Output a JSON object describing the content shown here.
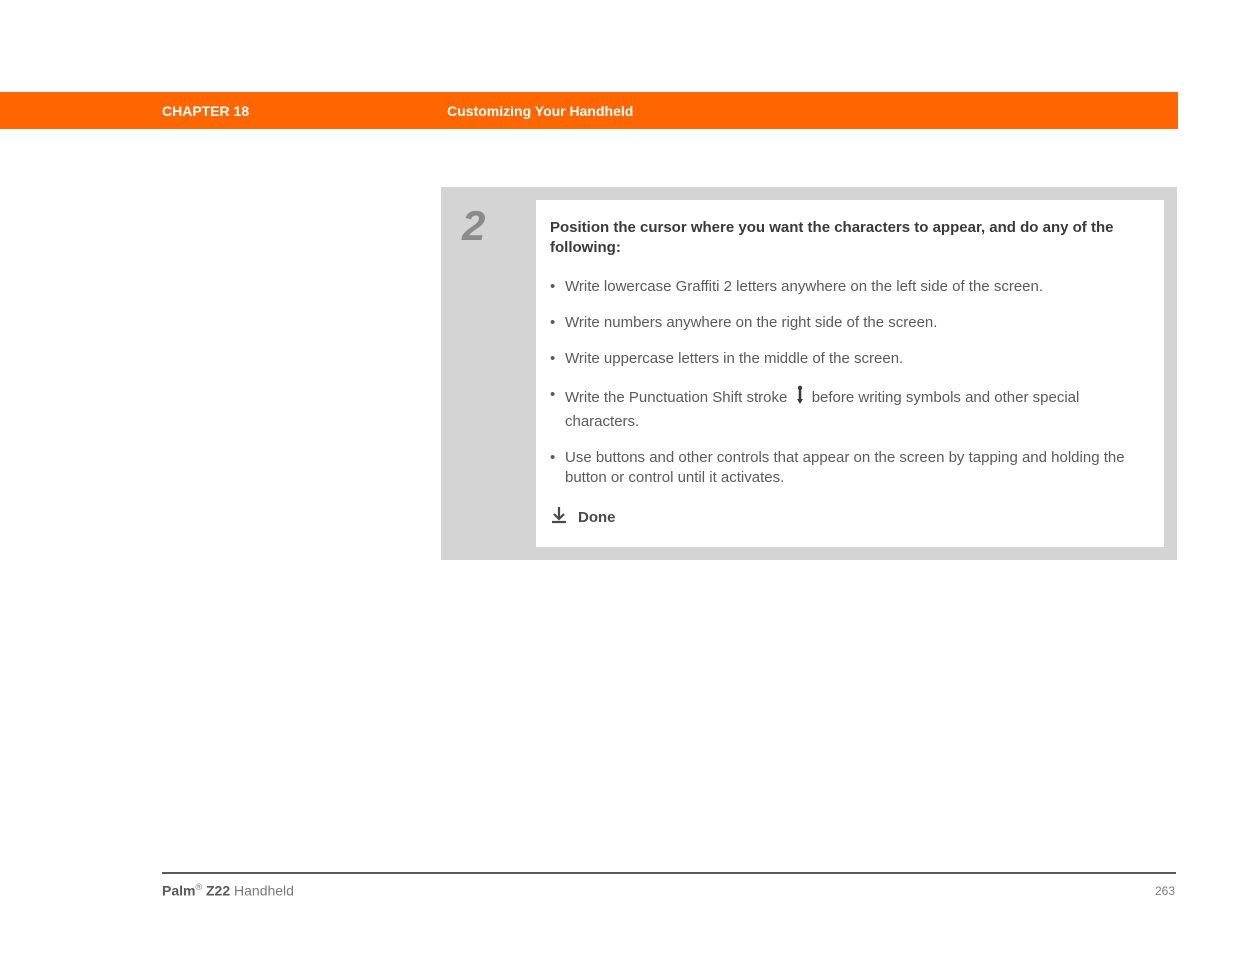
{
  "header": {
    "chapter": "CHAPTER 18",
    "title": "Customizing Your Handheld"
  },
  "step": {
    "number": "2",
    "intro": "Position the cursor where you want the characters to appear, and do any of the following:",
    "bullets": [
      "Write lowercase Graffiti 2 letters anywhere on the left side of the screen.",
      "Write numbers anywhere on the right side of the screen.",
      "Write uppercase letters in the middle of the screen.",
      {
        "before": "Write the Punctuation Shift stroke ",
        "after": " before writing symbols and other special characters."
      },
      "Use buttons and other controls that appear on the screen by tapping and holding the button or control until it activates."
    ],
    "done_label": "Done"
  },
  "footer": {
    "brand": "Palm",
    "reg": "®",
    "model": " Z22",
    "suffix": " Handheld",
    "page": "263"
  }
}
